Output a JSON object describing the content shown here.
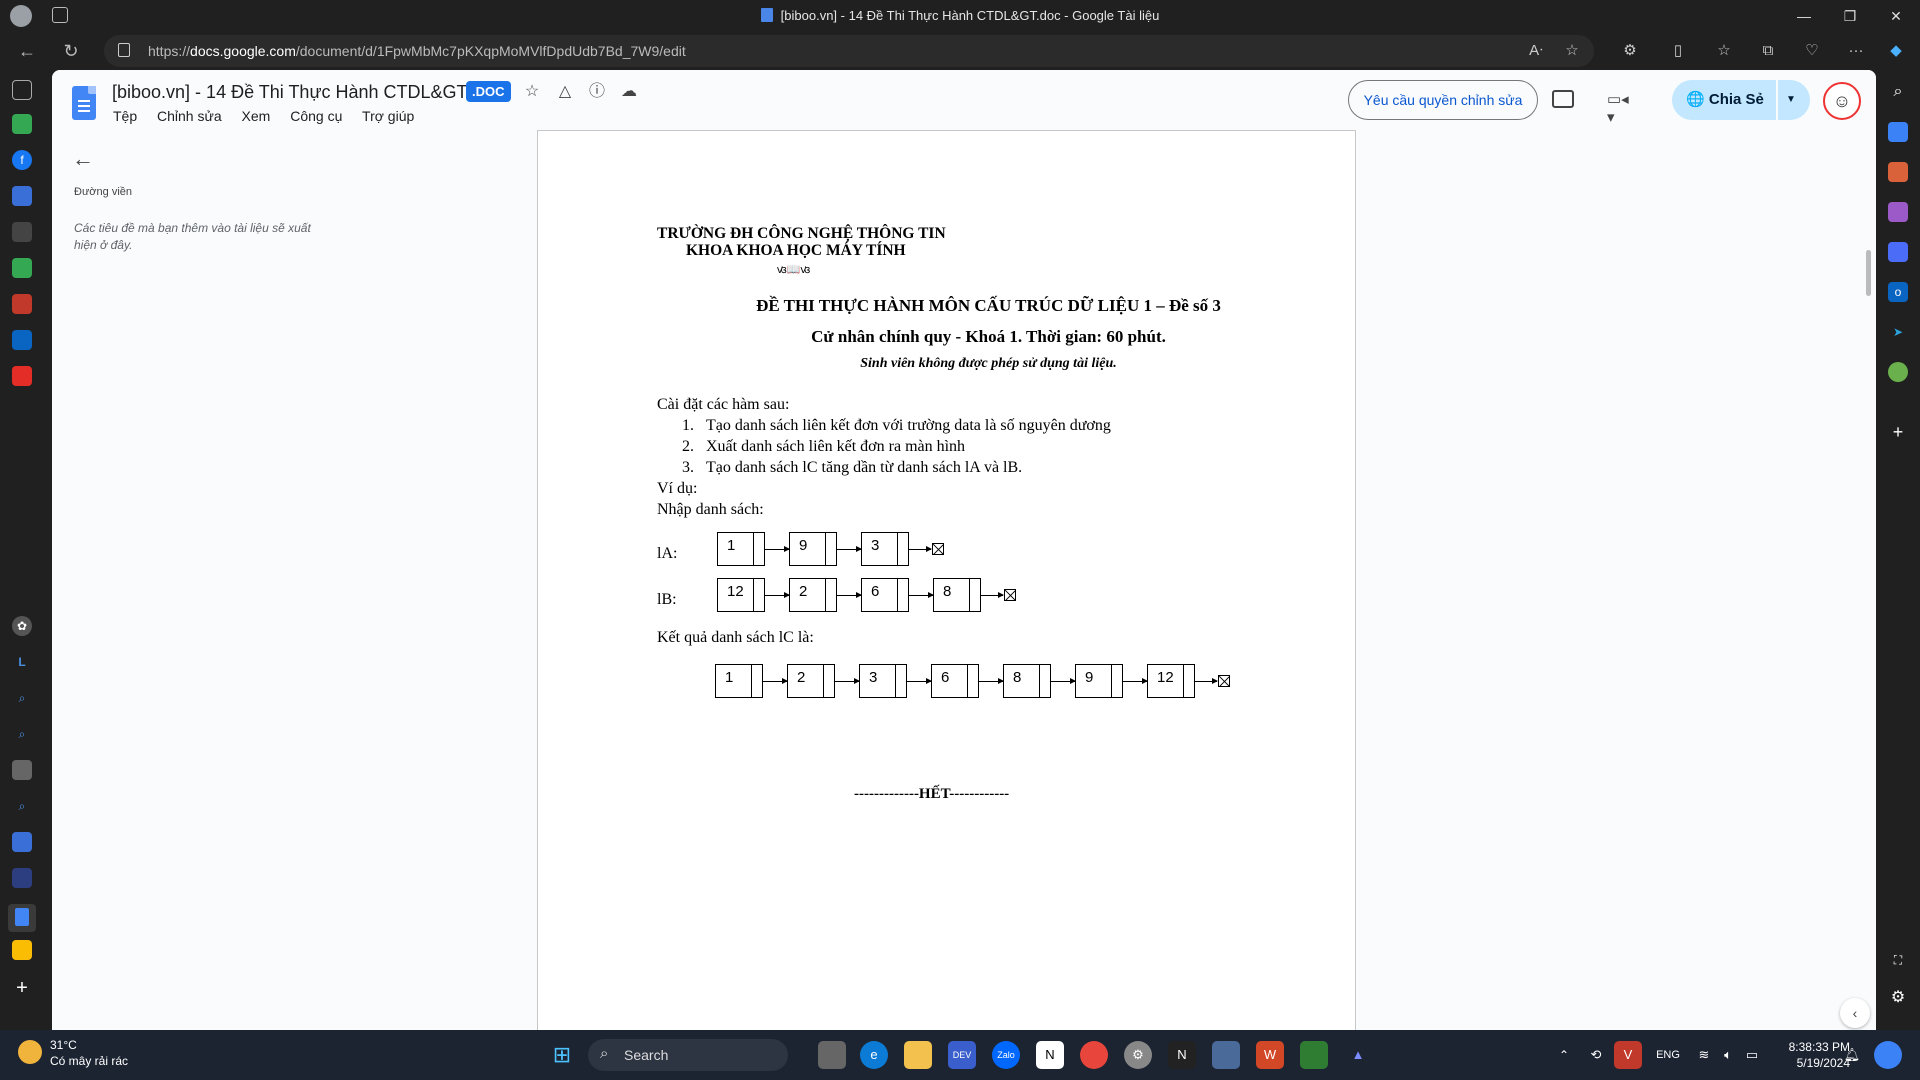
{
  "browser": {
    "window_title": "[biboo.vn] - 14 Đề Thi Thực Hành CTDL&GT.doc - Google Tài liệu",
    "url_prefix": "https://",
    "url_host": "docs.google.com",
    "url_path": "/document/d/1FpwMbMc7pKXqpMoMVlfDpdUdb7Bd_7W9/edit"
  },
  "docs": {
    "title": "[biboo.vn] - 14 Đề Thi Thực Hành CTDL&GT",
    "badge": ".DOC",
    "menu": [
      "Tệp",
      "Chỉnh sửa",
      "Xem",
      "Công cụ",
      "Trợ giúp"
    ],
    "request_edit": "Yêu cầu quyền chỉnh sửa",
    "share": "Chia Sẻ"
  },
  "outline": {
    "title": "Đường viền",
    "hint": "Các tiêu đề mà bạn thêm vào tài liệu sẽ xuất hiện ở đây."
  },
  "document": {
    "school": "TRƯỜNG ĐH CÔNG NGHỆ THÔNG TIN",
    "faculty": "KHOA KHOA HỌC MÁY TÍNH",
    "ornament": "ꟃ📖ꟃ",
    "exam_title": "ĐỀ THI THỰC HÀNH MÔN CẤU TRÚC DỮ LIỆU 1 – Đề số 3",
    "exam_sub": "Cử nhân chính quy - Khoá 1. Thời gian: 60 phút.",
    "exam_note": "Sinh viên không được phép sử dụng tài liệu.",
    "intro": "Cài đặt các hàm sau:",
    "tasks": [
      "Tạo danh sách liên kết đơn với trường data là số nguyên dương",
      "Xuất danh sách liên kết đơn ra màn hình",
      "Tạo danh sách lC tăng dần từ danh sách lA và lB."
    ],
    "example": "Ví dụ:",
    "input_label": "Nhập danh sách:",
    "la_label": "lA:",
    "la_values": [
      "1",
      "9",
      "3"
    ],
    "lb_label": "lB:",
    "lb_values": [
      "12",
      "2",
      "6",
      "8"
    ],
    "result_label": "Kết quả danh sách lC là:",
    "lc_values": [
      "1",
      "2",
      "3",
      "6",
      "8",
      "9",
      "12"
    ],
    "end": "-------------HẾT------------"
  },
  "taskbar": {
    "temperature": "31°C",
    "weather": "Có mây rải rác",
    "search": "Search",
    "lang": "ENG",
    "time": "8:38:33 PM",
    "date": "5/19/2024"
  }
}
